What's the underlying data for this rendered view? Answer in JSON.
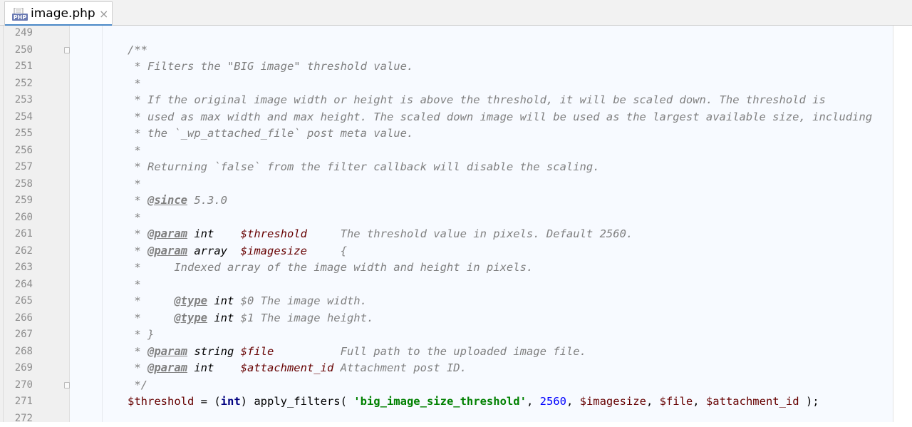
{
  "tab": {
    "title": "image.php",
    "close": "×",
    "icon": "php-file-icon"
  },
  "colors": {
    "comment": "#808080",
    "variable": "#660000",
    "keyword": "#000080",
    "string": "#008000",
    "number": "#0000ff",
    "gutter": "#f0f0f0",
    "code_bg": "#f7faff"
  },
  "line_numbers": [
    "249",
    "250",
    "251",
    "252",
    "253",
    "254",
    "255",
    "256",
    "257",
    "258",
    "259",
    "260",
    "261",
    "262",
    "263",
    "264",
    "265",
    "266",
    "267",
    "268",
    "269",
    "270",
    "271",
    "272"
  ],
  "code": {
    "l250": "/**",
    "l251": " * Filters the \"BIG image\" threshold value.",
    "l252": " *",
    "l253": " * If the original image width or height is above the threshold, it will be scaled down. The threshold is",
    "l254": " * used as max width and max height. The scaled down image will be used as the largest available size, including",
    "l255": " * the `_wp_attached_file` post meta value.",
    "l256": " *",
    "l257": " * Returning `false` from the filter callback will disable the scaling.",
    "l258": " *",
    "l259_star": " * ",
    "l259_tag": "@since",
    "l259_rest": " 5.3.0",
    "l260": " *",
    "l261_star": " * ",
    "l261_tag": "@param",
    "l261_type": " int    ",
    "l261_var": "$threshold",
    "l261_desc": "     The threshold value in pixels. Default 2560.",
    "l262_star": " * ",
    "l262_tag": "@param",
    "l262_type": " array  ",
    "l262_var": "$imagesize",
    "l262_desc": "     {",
    "l263": " *     Indexed array of the image width and height in pixels.",
    "l264": " *",
    "l265_star": " *     ",
    "l265_tag": "@type",
    "l265_type": " int",
    "l265_desc": " $0 The image width.",
    "l266_star": " *     ",
    "l266_tag": "@type",
    "l266_type": " int",
    "l266_desc": " $1 The image height.",
    "l267": " * }",
    "l268_star": " * ",
    "l268_tag": "@param",
    "l268_type": " string ",
    "l268_var": "$file",
    "l268_desc": "          Full path to the uploaded image file.",
    "l269_star": " * ",
    "l269_tag": "@param",
    "l269_type": " int    ",
    "l269_var": "$attachment_id",
    "l269_desc": " Attachment post ID.",
    "l270": " */",
    "l271_var1": "$threshold",
    "l271_p1": " = (",
    "l271_kw": "int",
    "l271_p2": ") apply_filters( ",
    "l271_str": "'big_image_size_threshold'",
    "l271_p3": ", ",
    "l271_num": "2560",
    "l271_p4": ", ",
    "l271_var2": "$imagesize",
    "l271_p5": ", ",
    "l271_var3": "$file",
    "l271_p6": ", ",
    "l271_var4": "$attachment_id",
    "l271_p7": " );"
  }
}
